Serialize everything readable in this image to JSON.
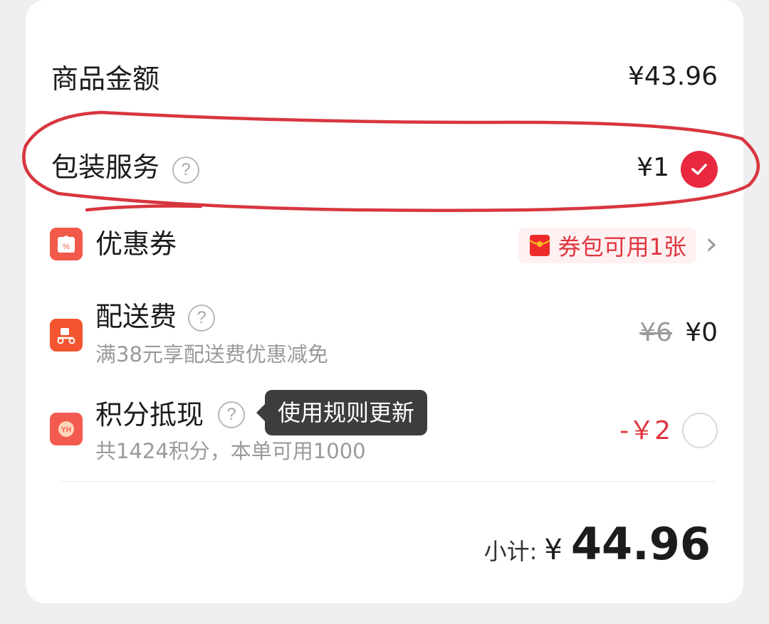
{
  "subtotal_goods": {
    "label": "商品金额",
    "amount": "¥43.96"
  },
  "packaging": {
    "label": "包装服务",
    "help": "?",
    "amount": "¥1",
    "checked": true
  },
  "coupon": {
    "label": "优惠券",
    "chip_text": "券包可用1张",
    "chevron": "›"
  },
  "delivery": {
    "label": "配送费",
    "help": "?",
    "note": "满38元享配送费优惠减免",
    "original_price": "¥6",
    "price": "¥0"
  },
  "points": {
    "label": "积分抵现",
    "help": "?",
    "tooltip": "使用规则更新",
    "note": "共1424积分，本单可用1000",
    "deduction": "-￥2",
    "checked": false
  },
  "total": {
    "label": "小计:",
    "currency": "¥",
    "value": "44.96"
  },
  "colors": {
    "accent": "#e8283f",
    "price_red": "#e0353f",
    "annotation": "#d8363f"
  },
  "icons": {
    "packaging_check": "check-icon",
    "coupon": "coupon-ticket-icon",
    "coupon_chip": "red-envelope-icon",
    "delivery": "scooter-icon",
    "points": "points-coin-icon"
  }
}
